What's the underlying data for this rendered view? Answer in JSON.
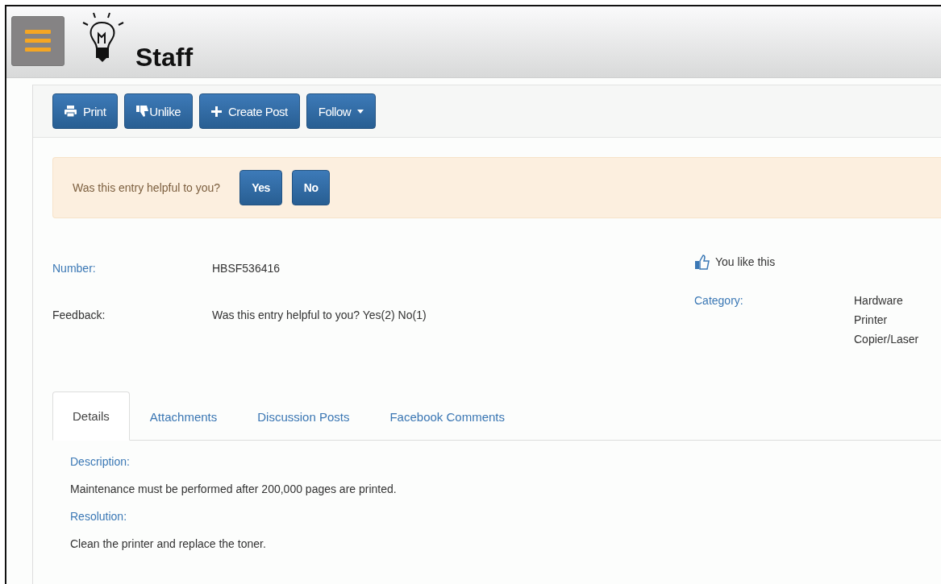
{
  "header": {
    "title": "Staff"
  },
  "toolbar": [
    {
      "label": "Print",
      "kind": "print"
    },
    {
      "label": "Unlike",
      "kind": "unlike"
    },
    {
      "label": "Create Post",
      "kind": "create"
    },
    {
      "label": "Follow",
      "kind": "dropdown"
    }
  ],
  "feedback_prompt": {
    "text": "Was this entry helpful to you?",
    "buttons": [
      "Yes",
      "No"
    ]
  },
  "fields": [
    {
      "label": "Number:",
      "value": "HBSF536416",
      "kind": "link"
    },
    {
      "label": "Feedback:",
      "value": "Was this entry helpful to you? Yes(2) No(1)",
      "kind": "plain"
    }
  ],
  "like_status": "You like this",
  "category": {
    "label": "Category:",
    "values": [
      "Hardware",
      "Printer",
      "Copier/Laser"
    ]
  },
  "tabs": [
    {
      "label": "Details",
      "selected": true
    },
    {
      "label": "Attachments",
      "selected": false
    },
    {
      "label": "Discussion Posts",
      "selected": false
    },
    {
      "label": "Facebook Comments",
      "selected": false
    }
  ],
  "sections": [
    {
      "heading": "Description:",
      "text": "Maintenance must be performed after 200,000 pages are printed."
    },
    {
      "heading": "Resolution:",
      "text": "Clean the printer and replace the toner."
    }
  ]
}
